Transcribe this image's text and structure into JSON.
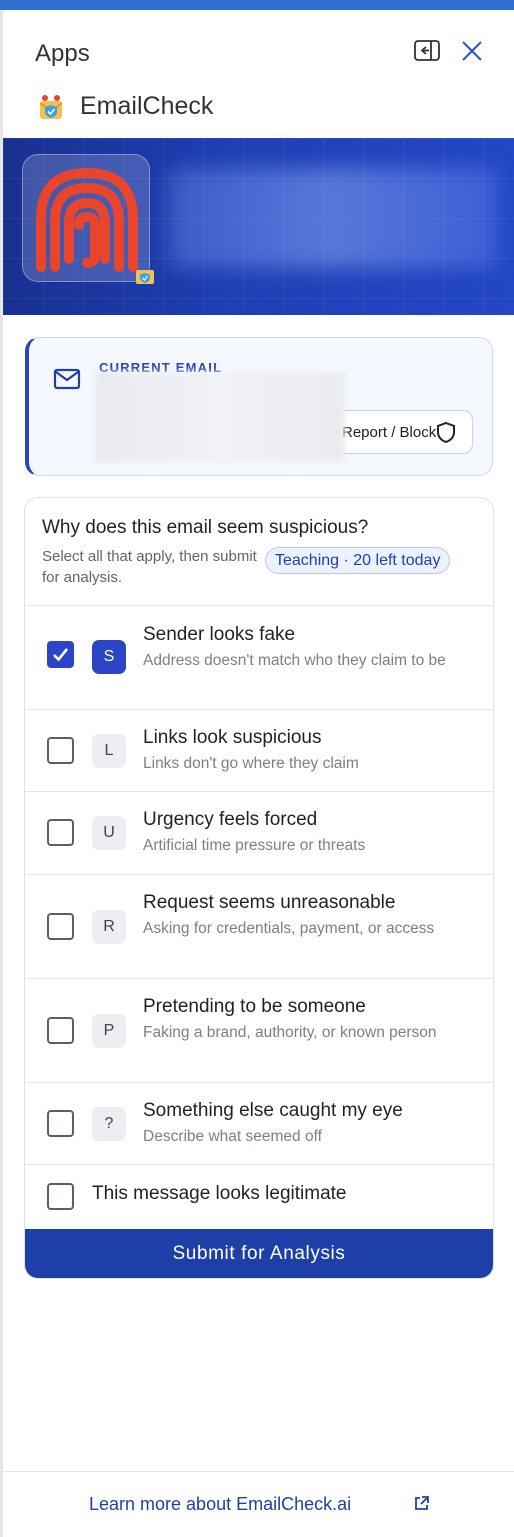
{
  "pane": {
    "title": "Apps"
  },
  "app": {
    "name": "EmailCheck"
  },
  "current_email": {
    "label": "CURRENT EMAIL",
    "report_label": "Report / Block"
  },
  "question": {
    "title": "Why does this email seem suspicious?",
    "subtitle": "Select all that apply, then submit for analysis.",
    "pill": "Teaching · 20 left today"
  },
  "options": [
    {
      "key": "S",
      "title": "Sender looks fake",
      "desc": "Address doesn't match who they claim to be",
      "checked": true
    },
    {
      "key": "L",
      "title": "Links look suspicious",
      "desc": "Links don't go where they claim",
      "checked": false
    },
    {
      "key": "U",
      "title": "Urgency feels forced",
      "desc": "Artificial time pressure or threats",
      "checked": false
    },
    {
      "key": "R",
      "title": "Request seems unreasonable",
      "desc": "Asking for credentials, payment, or access",
      "checked": false
    },
    {
      "key": "P",
      "title": "Pretending to be someone",
      "desc": "Faking a brand, authority, or known person",
      "checked": false
    },
    {
      "key": "?",
      "title": "Something else caught my eye",
      "desc": "Describe what seemed off",
      "checked": false
    }
  ],
  "legit": {
    "label": "This message looks legitimate",
    "checked": false
  },
  "submit": {
    "label": "Submit for Analysis"
  },
  "footer": {
    "link": "Learn more about EmailCheck.ai"
  },
  "colors": {
    "brand": "#1f3fa8",
    "accent": "#2c44c6",
    "logo": "#e8452c"
  },
  "icons": [
    "dock-icon",
    "close-icon",
    "app-icon",
    "mail-icon",
    "shield-icon",
    "checkmark-icon",
    "external-link-icon"
  ]
}
